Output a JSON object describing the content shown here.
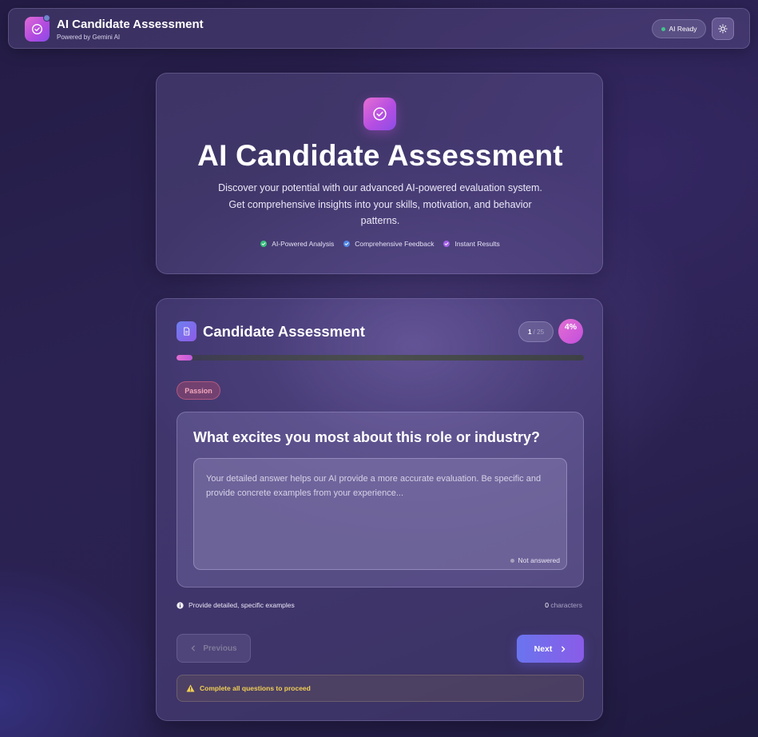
{
  "colors": {
    "accent_pink": "#e46ed2",
    "accent_indigo": "#6a74ee",
    "status_green": "#3fc58b",
    "warning_yellow": "#f2cf55"
  },
  "header": {
    "app_title": "AI Candidate Assessment",
    "app_subtitle": "Powered by Gemini AI",
    "logo_icon": "check-circle-icon",
    "status_label": "AI Ready",
    "theme_toggle_icon": "sun-icon"
  },
  "hero": {
    "icon": "check-circle-icon",
    "title": "AI Candidate Assessment",
    "description": "Discover your potential with our advanced AI-powered evaluation system. Get comprehensive insights into your skills, motivation, and behavior patterns.",
    "features": [
      {
        "label": "AI-Powered Analysis",
        "color": "#36c27a"
      },
      {
        "label": "Comprehensive Feedback",
        "color": "#4f86e6"
      },
      {
        "label": "Instant Results",
        "color": "#a35fe8"
      }
    ]
  },
  "assessment": {
    "icon": "document-icon",
    "title": "Candidate Assessment",
    "current_question": "1",
    "total_questions": "/ 25",
    "percent_complete": "4%",
    "progress_fraction": 0.04,
    "category": "Passion",
    "question": "What excites you most about this role or industry?",
    "answer_value": "",
    "answer_placeholder": "Your detailed answer helps our AI provide a more accurate evaluation. Be specific and provide concrete examples from your experience...",
    "answer_status": "Not answered",
    "hint": "Provide detailed, specific examples",
    "char_count": "0",
    "char_label": "characters",
    "prev_label": "Previous",
    "next_label": "Next",
    "warning": "Complete all questions to proceed"
  }
}
